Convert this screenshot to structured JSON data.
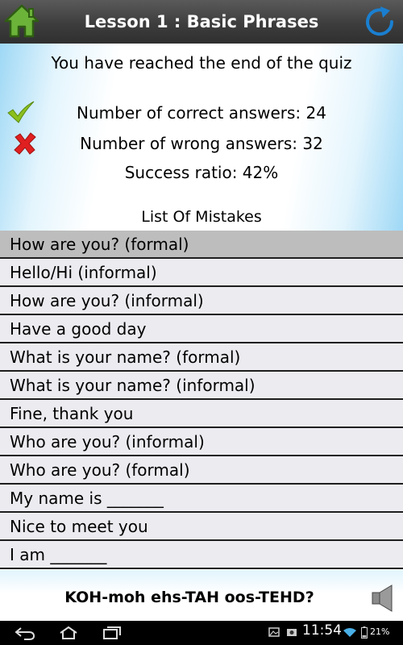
{
  "header": {
    "title": "Lesson 1 : Basic Phrases",
    "home_icon": "home-icon",
    "refresh_icon": "refresh-icon"
  },
  "summary": {
    "end_message": "You have reached the end of the quiz",
    "correct_label": "Number of correct answers: 24",
    "wrong_label": "Number of wrong answers: 32",
    "ratio_label": "Success ratio: 42%",
    "correct_count": 24,
    "wrong_count": 32,
    "success_ratio": 0.42
  },
  "mistakes": {
    "title": "List Of Mistakes",
    "items": [
      "How are you? (formal)",
      "Hello/Hi (informal)",
      "How are you? (informal)",
      "Have a good day",
      "What is your name? (formal)",
      "What is your name? (informal)",
      "Fine, thank you",
      "Who are you? (informal)",
      "Who are you? (formal)",
      "My name is _______",
      "Nice to meet you",
      "I am _______"
    ]
  },
  "bottom": {
    "pronunciation": "KOH-moh ehs-TAH oos-TEHD?",
    "speaker_icon": "speaker-icon"
  },
  "status_bar": {
    "time": "11:54",
    "battery": "21%"
  },
  "colors": {
    "header_bg": "#3d3d3d",
    "accent_blue": "#1a7fd0",
    "check_green": "#8bbf1e",
    "cross_red": "#e02020",
    "selected_row": "#bdbdbd",
    "row_bg": "#ecebf0"
  }
}
